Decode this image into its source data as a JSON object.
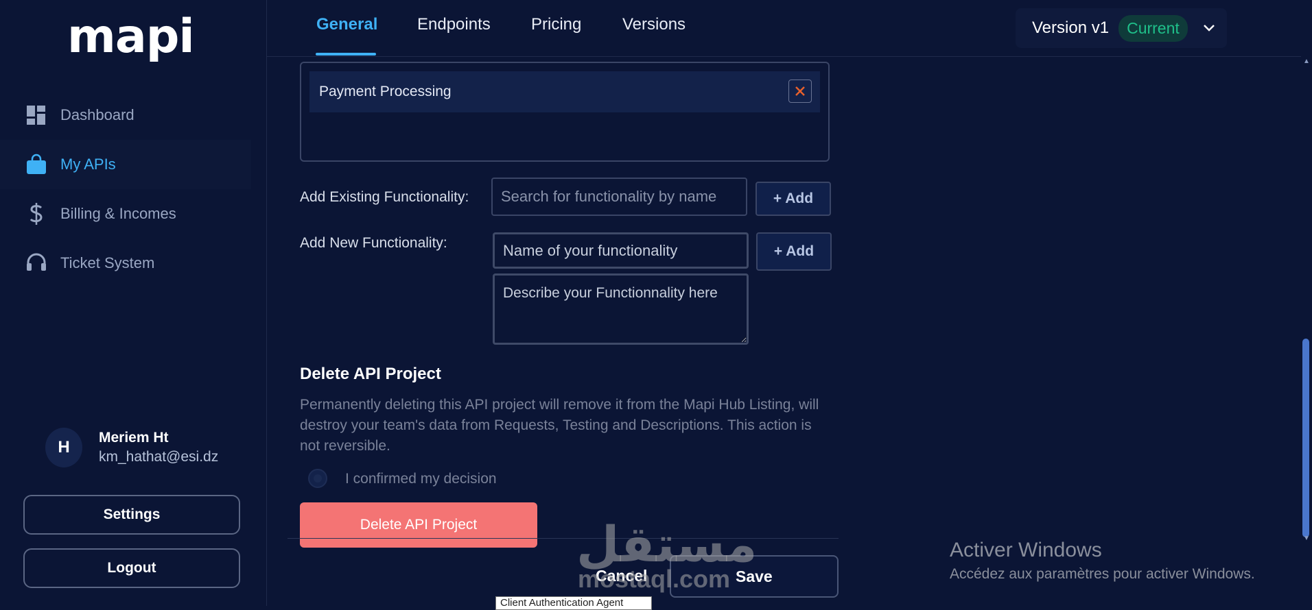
{
  "app": {
    "logo": "mapi"
  },
  "sidebar": {
    "items": [
      {
        "label": "Dashboard",
        "icon": "dashboard-icon",
        "active": false
      },
      {
        "label": "My APIs",
        "icon": "bag-icon",
        "active": true
      },
      {
        "label": "Billing & Incomes",
        "icon": "dollar-icon",
        "active": false
      },
      {
        "label": "Ticket System",
        "icon": "headset-icon",
        "active": false
      }
    ],
    "user": {
      "initial": "H",
      "name": "Meriem Ht",
      "email": "km_hathat@esi.dz"
    },
    "settings_label": "Settings",
    "logout_label": "Logout"
  },
  "header": {
    "tabs": [
      {
        "label": "General",
        "active": true
      },
      {
        "label": "Endpoints",
        "active": false
      },
      {
        "label": "Pricing",
        "active": false
      },
      {
        "label": "Versions",
        "active": false
      }
    ],
    "version": {
      "label": "Version v1",
      "badge": "Current"
    }
  },
  "functionalities": {
    "items": [
      {
        "label": "Payment Processing"
      }
    ],
    "add_existing_label": "Add Existing Functionality:",
    "search_placeholder": "Search for functionality by name",
    "add_button_label": "+ Add",
    "add_new_label": "Add New Functionality:",
    "name_placeholder": "Name of your functionality",
    "description_placeholder": "Describe your Functionnality here"
  },
  "delete_section": {
    "title": "Delete API Project",
    "warning": "Permanently deleting this API project will remove it from the Mapi Hub Listing, will destroy your team's data from Requests, Testing and Descriptions. This action is not reversible.",
    "confirm_label": "I confirmed my decision",
    "button_label": "Delete API Project"
  },
  "footer": {
    "cancel_label": "Cancel",
    "save_label": "Save",
    "tooltip": "Client Authentication Agent"
  },
  "overlay": {
    "watermark_ar": "مستقل",
    "watermark_latin": "mostaql.com",
    "windows_title": "Activer Windows",
    "windows_subtitle": "Accédez aux paramètres pour activer Windows."
  },
  "colors": {
    "background": "#0b1535",
    "accent": "#3fb1f5",
    "badge_green": "#1fc08a",
    "danger": "#f47474"
  }
}
